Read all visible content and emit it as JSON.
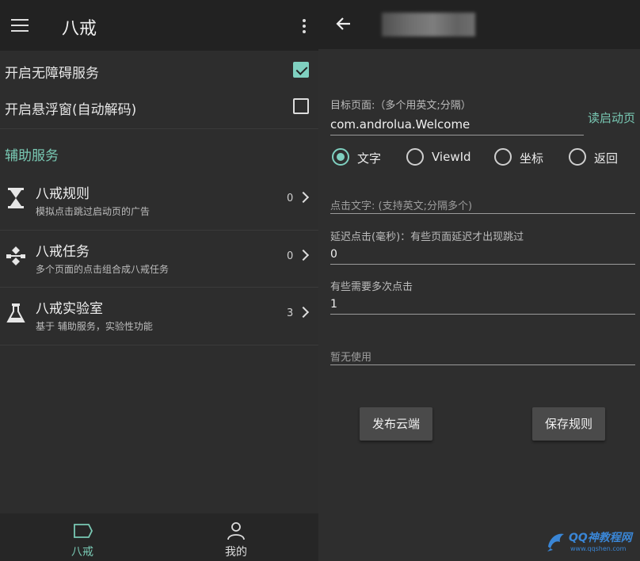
{
  "left": {
    "appbar": {
      "title": "八戒"
    },
    "toggles": [
      {
        "label": "开启无障碍服务",
        "checked": true
      },
      {
        "label": "开启悬浮窗(自动解码)",
        "checked": false
      }
    ],
    "section_header": "辅助服务",
    "items": [
      {
        "title": "八戒规则",
        "subtitle": "模拟点击跳过启动页的广告",
        "count": "0",
        "icon": "hourglass-icon"
      },
      {
        "title": "八戒任务",
        "subtitle": "多个页面的点击组合成八戒任务",
        "count": "0",
        "icon": "workflow-icon"
      },
      {
        "title": "八戒实验室",
        "subtitle": "基于 辅助服务，实验性功能",
        "count": "3",
        "icon": "flask-icon"
      }
    ],
    "bottom_nav": [
      {
        "label": "八戒",
        "icon": "tag-icon",
        "active": true
      },
      {
        "label": "我的",
        "icon": "person-icon",
        "active": false
      }
    ],
    "colors": {
      "accent": "#79c9b4",
      "background": "#2d2d2d",
      "appbar": "#222222"
    }
  },
  "right": {
    "target_page": {
      "label": "目标页面:（多个用英文;分隔）",
      "value": "com.androlua.Welcome",
      "action_label": "读启动页"
    },
    "radio_options": [
      {
        "label": "文字",
        "selected": true
      },
      {
        "label": "ViewId",
        "selected": false
      },
      {
        "label": "坐标",
        "selected": false
      },
      {
        "label": "返回",
        "selected": false
      }
    ],
    "click_text": {
      "placeholder": "点击文字: (支持英文;分隔多个)"
    },
    "delay": {
      "label": "延迟点击(毫秒)：有些页面延迟才出现跳过",
      "value": "0"
    },
    "repeat": {
      "label": "有些需要多次点击",
      "value": "1"
    },
    "unused": {
      "placeholder": "暂无使用"
    },
    "buttons": {
      "publish": "发布云端",
      "save": "保存规则"
    },
    "watermark": {
      "text": "QQ神教程网",
      "url": "www.qqshen.com"
    }
  }
}
